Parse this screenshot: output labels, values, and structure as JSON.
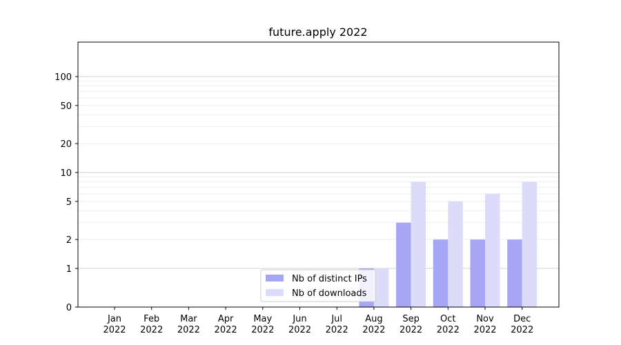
{
  "chart_data": {
    "type": "bar",
    "title": "future.apply 2022",
    "xlabel": "",
    "ylabel": "",
    "yscale": "symlog",
    "ylim": [
      0,
      100
    ],
    "yticks": [
      0,
      1,
      2,
      5,
      10,
      20,
      50,
      100
    ],
    "ytick_labels": [
      "0",
      "1",
      "2",
      "5",
      "10",
      "20",
      "50",
      "100"
    ],
    "categories": [
      "Jan\n2022",
      "Feb\n2022",
      "Mar\n2022",
      "Apr\n2022",
      "May\n2022",
      "Jun\n2022",
      "Jul\n2022",
      "Aug\n2022",
      "Sep\n2022",
      "Oct\n2022",
      "Nov\n2022",
      "Dec\n2022"
    ],
    "series": [
      {
        "name": "Nb of distinct IPs",
        "color": "#a6a6f5",
        "values": [
          0,
          0,
          0,
          0,
          0,
          0,
          0,
          1,
          3,
          2,
          2,
          2
        ]
      },
      {
        "name": "Nb of downloads",
        "color": "#dcdcfa",
        "values": [
          0,
          0,
          0,
          0,
          0,
          0,
          0,
          1,
          8,
          5,
          6,
          8
        ]
      }
    ],
    "legend": "bottom-center",
    "grid": true
  }
}
